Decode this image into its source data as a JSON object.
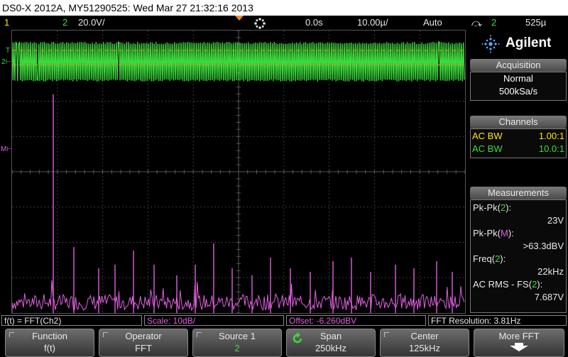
{
  "title": "DS0-X 2012A, MY51290525: Wed Mar 27 21:32:16 2013",
  "status": {
    "ch1_num": "1",
    "ch2_num": "2",
    "ch2_scale": "20.0V/",
    "time_offset": "0.0s",
    "time_scale": "10.00µ/",
    "trigger_mode": "Auto",
    "trigger_source": "2",
    "trigger_level": "525µ"
  },
  "screen": {
    "marker_t": "T",
    "marker_2": "2",
    "marker_m": "M"
  },
  "side": {
    "brand": "Agilent",
    "acquisition": {
      "header": "Acquisition",
      "mode": "Normal",
      "rate": "500kSa/s"
    },
    "channels": {
      "header": "Channels",
      "rows": [
        {
          "label": "AC BW",
          "value": "1.00:1"
        },
        {
          "label": "AC BW",
          "value": "10.0:1"
        }
      ]
    },
    "measurements": {
      "header": "Measurements",
      "items": [
        {
          "name": "Pk-Pk(",
          "src": "2",
          "close": "):",
          "value": "23V"
        },
        {
          "name": "Pk-Pk(",
          "src": "M",
          "close": "):",
          "value": ">63.3dBV"
        },
        {
          "name": "Freq(",
          "src": "2",
          "close": "):",
          "value": "22kHz"
        },
        {
          "name": "AC RMS - FS(",
          "src": "2",
          "close": "):",
          "value": "7.687V"
        }
      ]
    }
  },
  "info": {
    "function": "f(t) = FFT(Ch2)",
    "scale": "Scale: 10dB/",
    "offset": "Offset: -6.260dBV",
    "resolution": "FFT Resolution: 3.81Hz"
  },
  "softkeys": [
    {
      "label": "Function",
      "value": "f(t)"
    },
    {
      "label": "Operator",
      "value": "FFT"
    },
    {
      "label": "Source 1",
      "value": "2"
    },
    {
      "label": "Span",
      "value": "250kHz"
    },
    {
      "label": "Center",
      "value": "125kHz"
    },
    {
      "label": "More FFT",
      "value": ""
    }
  ],
  "colors": {
    "ch1": "#ffe600",
    "ch2": "#3ddc3d",
    "math": "#e060e0",
    "grid": "#3a3a3a"
  }
}
